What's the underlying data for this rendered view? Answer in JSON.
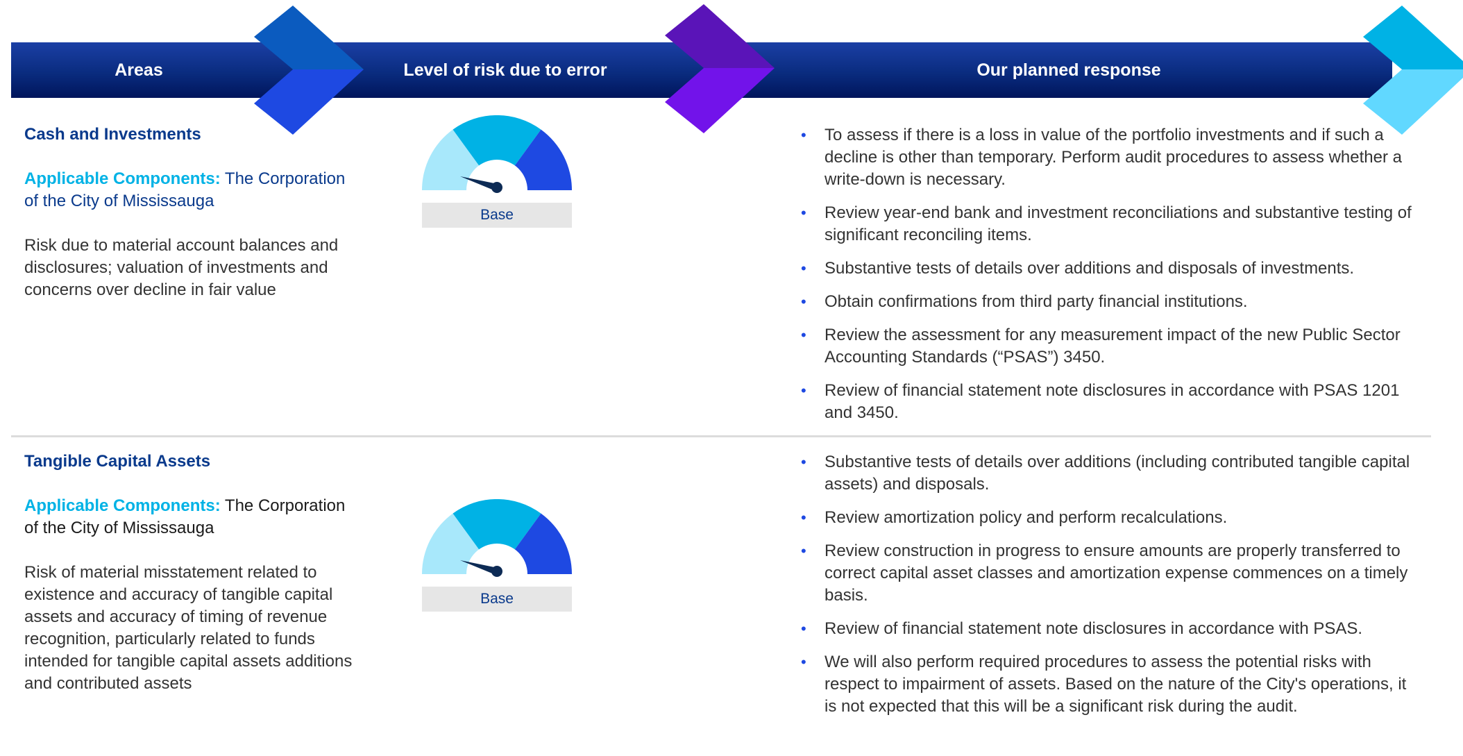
{
  "header": {
    "areas_label": "Areas",
    "risk_label": "Level of risk due to error",
    "response_label": "Our planned response"
  },
  "colors": {
    "header_dark": "#00155c",
    "chevron_blue": "#1e49e2",
    "chevron_purple": "#7213ea",
    "chevron_cyan": "#00b2e5",
    "title_blue": "#0a3a8c"
  },
  "rows": [
    {
      "area_title": "Cash and Investments",
      "components_label": "Applicable Components:",
      "components_value": "The Corporation of the City of Mississauga",
      "risk_description": "Risk due to material account balances and disclosures; valuation of investments and concerns over decline in fair value",
      "risk_level": "Base",
      "responses": [
        "To assess if there is a loss in value of the portfolio investments and if such a decline is other than temporary. Perform audit procedures to assess whether a write-down is necessary.",
        "Review year-end bank and investment reconciliations and substantive testing of significant reconciling items.",
        "Substantive tests of details over additions and disposals of investments.",
        "Obtain confirmations from third party financial institutions.",
        "Review the assessment for any measurement impact of the new Public Sector Accounting Standards (“PSAS”) 3450.",
        "Review of financial statement note disclosures in accordance with PSAS 1201 and 3450."
      ]
    },
    {
      "area_title": "Tangible Capital Assets",
      "components_label": "Applicable Components:",
      "components_value": "The Corporation of the City of Mississauga",
      "risk_description": "Risk of material misstatement related to existence and accuracy of tangible capital assets and accuracy of timing of revenue recognition, particularly related to funds intended for tangible capital assets additions and contributed assets",
      "risk_level": "Base",
      "responses": [
        "Substantive tests of details over additions (including contributed tangible capital assets) and disposals.",
        "Review amortization policy and perform recalculations.",
        "Review construction in progress to ensure amounts are properly transferred to correct capital asset classes and amortization expense commences on a timely basis.",
        "Review of financial statement note disclosures in accordance with PSAS.",
        "We will also perform required procedures to assess the potential risks with respect to impairment of assets. Based on the nature of the City's operations, it is not expected that this will be a significant risk during the audit."
      ]
    }
  ]
}
